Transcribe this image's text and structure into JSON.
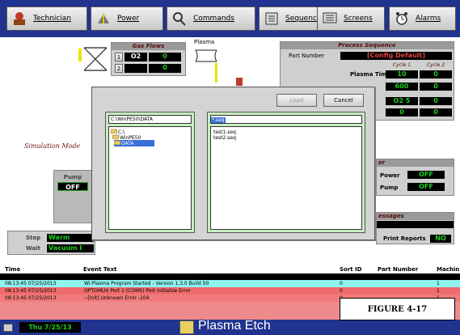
{
  "toolbar": {
    "buttons": [
      {
        "label": "Technician",
        "icon": "technician-icon"
      },
      {
        "label": "Power",
        "icon": "power-icon"
      },
      {
        "label": "Commands",
        "icon": "commands-icon"
      },
      {
        "label": "Sequence",
        "icon": "sequence-icon"
      },
      {
        "label": "Screens",
        "icon": "screens-icon"
      },
      {
        "label": "Alarms",
        "icon": "alarms-icon"
      }
    ]
  },
  "gas_flows": {
    "title": "Gas Flows",
    "rows": [
      {
        "num": "1",
        "gas": "O2",
        "value": "0"
      },
      {
        "num": "2",
        "gas": "",
        "value": "0"
      }
    ]
  },
  "plasma": {
    "label": "Plasma"
  },
  "process_sequence": {
    "title": "Process Sequence",
    "part_number_label": "Part Number",
    "part_number_value": "[Config Default]",
    "cycle1_label": "Cycle 1",
    "cycle2_label": "Cycle 2",
    "plasma_time_label": "Plasma Time",
    "plasma_time_c1": "10",
    "plasma_time_c2": "0",
    "row2_c1": "600",
    "row2_c2": "0",
    "row3_c1": "O2 5",
    "row3_c2": "0",
    "row4_c1": "0",
    "row4_c2": "0"
  },
  "simulation_mode": "Simulation Mode",
  "pump_panel": {
    "label": "Pump",
    "value": "OFF"
  },
  "power_panel": {
    "title": "er",
    "power_label": "Power",
    "power_value": "OFF",
    "pump_label": "Pump",
    "pump_value": "OFF"
  },
  "messages_panel": {
    "title": "essages",
    "print_reports_label": "Print Reports",
    "print_reports_value": "NO"
  },
  "step_panel": {
    "step_label": "Step",
    "step_value": "Warm",
    "wait_label": "Wait",
    "wait_value": "Vacuum I"
  },
  "dialog": {
    "load_label": "Load",
    "cancel_label": "Cancel",
    "path": "C:\\WinPE50\\DATA",
    "folders": [
      "C:\\",
      "WinPE50",
      "DATA"
    ],
    "filter_value": "*.seq",
    "files": [
      "test1.seq",
      "test2.seq"
    ]
  },
  "events": {
    "headers": {
      "time": "Time",
      "event_text": "Event Text",
      "sort_id": "Sort ID",
      "part_number": "Part Number",
      "machine": "Machin"
    },
    "rows": [
      {
        "time": "08:13:45 07/25/2013",
        "text": "Wi-Plasma Program Started - Version 1.3.0   Build 50",
        "sort": "0",
        "machine": "1",
        "color": "#8ff3f0"
      },
      {
        "time": "08:13:45 07/25/2013",
        "text": "OPTOMUX Port 1 (COM5) Port Initialize Error",
        "sort": "0",
        "machine": "1",
        "color": "#f06b6b"
      },
      {
        "time": "08:13:45 07/25/2013",
        "text": "  --[Init]  Unknown Error -104",
        "sort": "0",
        "machine": "1",
        "color": "#f07a7a"
      }
    ]
  },
  "statusbar": {
    "date": "Thu 7/25/13",
    "app_title": "Plasma Etch"
  },
  "figure_label": "FIGURE 4-17",
  "colors": {
    "toolbar_bg": "#20338f",
    "lcd_green": "#1fd01f",
    "lcd_bg": "#000000",
    "dialog_select": "#3a6ed8"
  }
}
